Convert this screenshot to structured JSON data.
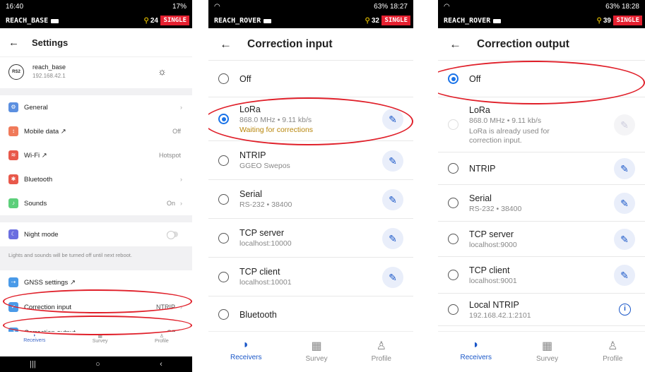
{
  "panel1": {
    "status": {
      "time": "16:40",
      "right": "17%",
      "device": "REACH_BASE",
      "sats": "24",
      "mode": "SINGLE"
    },
    "header": {
      "title": "Settings"
    },
    "device": {
      "badge": "RS2",
      "name": "reach_base",
      "ip": "192.168.42.1"
    },
    "group1": [
      {
        "label": "General",
        "value": "",
        "icon_color": "#5b8fe0",
        "icon": "gear-icon"
      },
      {
        "label": "Mobile data ↗",
        "value": "Off",
        "icon_color": "#f07a5a",
        "icon": "signal-icon"
      },
      {
        "label": "Wi-Fi ↗",
        "value": "Hotspot",
        "icon_color": "#e8584a",
        "icon": "wifi-icon"
      },
      {
        "label": "Bluetooth",
        "value": "",
        "icon_color": "#e8584a",
        "icon": "bluetooth-icon"
      },
      {
        "label": "Sounds",
        "value": "On",
        "icon_color": "#5ccf7a",
        "icon": "speaker-icon"
      }
    ],
    "night_mode": {
      "label": "Night mode",
      "icon_color": "#6a6ee0"
    },
    "note": "Lights and sounds will be turned off until next reboot.",
    "group2": [
      {
        "label": "GNSS settings ↗",
        "value": "",
        "icon_color": "#4a9ae8"
      },
      {
        "label": "Correction input",
        "value": "NTRIP",
        "icon_color": "#4a9ae8"
      },
      {
        "label": "Correction output",
        "value": "Off",
        "icon_color": "#4a9ae8"
      }
    ],
    "nav": [
      {
        "label": "Receivers",
        "active": true
      },
      {
        "label": "Survey",
        "active": false
      },
      {
        "label": "Profile",
        "active": false
      }
    ]
  },
  "panel2": {
    "status": {
      "right": "63% 18:27",
      "device": "REACH_ROVER",
      "sats": "32",
      "mode": "SINGLE"
    },
    "header": {
      "title": "Correction input"
    },
    "options": [
      {
        "title": "Off",
        "sub": "",
        "sub2": "",
        "status": "",
        "selected": false,
        "edit": false
      },
      {
        "title": "LoRa",
        "sub": "868.0 MHz • 9.11 kb/s",
        "sub2": "",
        "status": "Waiting for corrections",
        "selected": true,
        "edit": true
      },
      {
        "title": "NTRIP",
        "sub": "GGEO Swepos",
        "sub2": "",
        "status": "",
        "selected": false,
        "edit": true
      },
      {
        "title": "Serial",
        "sub": "RS-232 • 38400",
        "sub2": "",
        "status": "",
        "selected": false,
        "edit": true
      },
      {
        "title": "TCP server",
        "sub": "localhost:10000",
        "sub2": "",
        "status": "",
        "selected": false,
        "edit": true
      },
      {
        "title": "TCP client",
        "sub": "localhost:10001",
        "sub2": "",
        "status": "",
        "selected": false,
        "edit": true
      },
      {
        "title": "Bluetooth",
        "sub": "",
        "sub2": "",
        "status": "",
        "selected": false,
        "edit": false
      }
    ],
    "nav": [
      {
        "label": "Receivers",
        "active": true
      },
      {
        "label": "Survey",
        "active": false
      },
      {
        "label": "Profile",
        "active": false
      }
    ]
  },
  "panel3": {
    "status": {
      "right": "63% 18:28",
      "device": "REACH_ROVER",
      "sats": "39",
      "mode": "SINGLE"
    },
    "header": {
      "title": "Correction output"
    },
    "options": [
      {
        "title": "Off",
        "sub": "",
        "sub2": "",
        "selected": true,
        "edit": false,
        "disabled": false
      },
      {
        "title": "LoRa",
        "sub": "868.0 MHz • 9.11 kb/s",
        "sub2": "LoRa is already used for",
        "sub3": "correction input.",
        "selected": false,
        "edit": true,
        "disabled": true
      },
      {
        "title": "NTRIP",
        "sub": "",
        "sub2": "",
        "selected": false,
        "edit": true,
        "disabled": false
      },
      {
        "title": "Serial",
        "sub": "RS-232 • 38400",
        "sub2": "",
        "selected": false,
        "edit": true,
        "disabled": false
      },
      {
        "title": "TCP server",
        "sub": "localhost:9000",
        "sub2": "",
        "selected": false,
        "edit": true,
        "disabled": false
      },
      {
        "title": "TCP client",
        "sub": "localhost:9001",
        "sub2": "",
        "selected": false,
        "edit": true,
        "disabled": false
      },
      {
        "title": "Local NTRIP",
        "sub": "192.168.42.1:2101",
        "sub2": "",
        "selected": false,
        "edit": false,
        "disabled": false,
        "info": true
      }
    ],
    "nav": [
      {
        "label": "Receivers",
        "active": true
      },
      {
        "label": "Survey",
        "active": false
      },
      {
        "label": "Profile",
        "active": false
      }
    ]
  }
}
